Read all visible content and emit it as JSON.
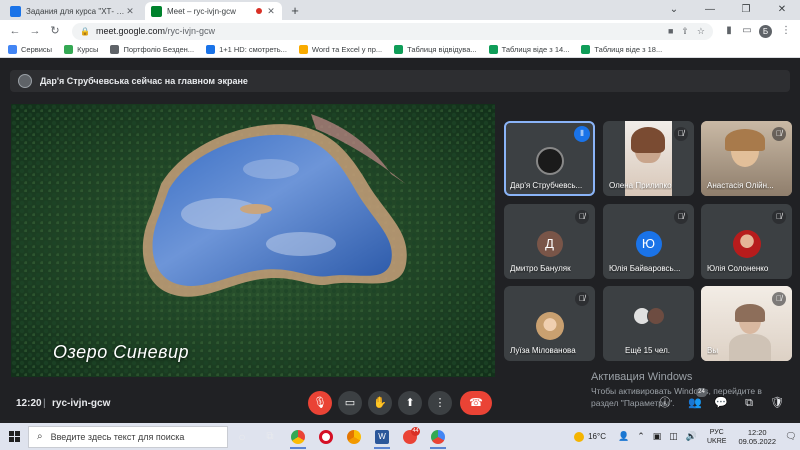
{
  "browser": {
    "tabs": [
      {
        "title": "Задания для курса \"ХТ- 149 ФЭ...",
        "favicon_color": "#1a73e8",
        "active": false
      },
      {
        "title": "Meet – ryc-ivjn-gcw",
        "favicon_color": "#00832d",
        "active": true
      }
    ],
    "new_tab_glyph": "+",
    "window_controls": {
      "minimize": "⌄",
      "min2": "—",
      "restore": "❐",
      "close": "✕"
    },
    "nav": {
      "back": "←",
      "forward": "→",
      "reload": "↻"
    },
    "url_host": "meet.google.com",
    "url_path": "/ryc-ivjn-gcw",
    "profile_initial": "Б",
    "bookmarks": [
      {
        "label": "Сервисы",
        "color": "#4285f4"
      },
      {
        "label": "Курсы",
        "color": "#34a853"
      },
      {
        "label": "Портфоліо Безден...",
        "color": "#5f6368"
      },
      {
        "label": "1+1 HD: смотреть...",
        "color": "#1a73e8"
      },
      {
        "label": "Word та Excel у пр...",
        "color": "#f9ab00"
      },
      {
        "label": "Таблиця відвідува...",
        "color": "#0f9d58"
      },
      {
        "label": "Таблиця віде з 14...",
        "color": "#0f9d58"
      },
      {
        "label": "Таблиця віде з 18...",
        "color": "#0f9d58"
      }
    ]
  },
  "meet": {
    "presenter_banner": "Дар'я Струбчевська сейчас на главном экране",
    "stage_caption": "Озеро Синевир",
    "tiles": [
      {
        "name": "Дар'я Струбчевсь...",
        "kind": "photo",
        "color": "#1a1a1a",
        "bg": "#3c4043",
        "speaking": true,
        "badge": "audio"
      },
      {
        "name": "Олена Прилипко",
        "kind": "video",
        "color": "#c9a58c",
        "bg": "#e9e4df",
        "speaking": false,
        "badge": "mute"
      },
      {
        "name": "Анастасія Олійн...",
        "kind": "video",
        "color": "#d6b08a",
        "bg": "#b9a997",
        "speaking": false,
        "badge": "mute"
      },
      {
        "name": "Дмитро Бануляк",
        "kind": "initial",
        "initial": "Д",
        "color": "#795548",
        "bg": "#3c4043",
        "speaking": false,
        "badge": "mute"
      },
      {
        "name": "Юлія Байваровсь...",
        "kind": "initial",
        "initial": "Ю",
        "color": "#1a73e8",
        "bg": "#3c4043",
        "speaking": false,
        "badge": "mute"
      },
      {
        "name": "Юлія Солоненко",
        "kind": "photo",
        "color": "#b71c1c",
        "bg": "#3c4043",
        "speaking": false,
        "badge": "mute"
      },
      {
        "name": "Луїза Мілованова",
        "kind": "photo",
        "color": "#e8c9a0",
        "bg": "#3c4043",
        "speaking": false,
        "badge": "mute"
      },
      {
        "name": "Ещё 15 чел.",
        "kind": "group",
        "color": "#e8e8e8",
        "bg": "#3c4043",
        "speaking": false,
        "badge": "none"
      },
      {
        "name": "Вы",
        "kind": "video",
        "color": "#d9b8a0",
        "bg": "#ede6de",
        "speaking": false,
        "badge": "mute"
      }
    ],
    "activation_title": "Активация Windows",
    "activation_text": "Чтобы активировать Windows, перейдите в раздел \"Параметры\".",
    "time": "12:20",
    "separator": "|",
    "meeting_code": "ryc-ivjn-gcw",
    "controls": {
      "mic": "🎙",
      "camera": "▭",
      "hand": "✋",
      "present": "⬆",
      "more": "⋮",
      "end": "☎"
    },
    "right_icons": {
      "info": "ⓘ",
      "people": "👥",
      "people_count": "24",
      "chat": "💬",
      "activities": "⧉",
      "safety": "🛡"
    }
  },
  "taskbar": {
    "search_placeholder": "Введите здесь текст для поиска",
    "apps": [
      {
        "name": "cortana",
        "color": "#1f1f1f"
      },
      {
        "name": "task-view",
        "color": "#1f1f1f"
      },
      {
        "name": "chrome",
        "color": "#34a853"
      },
      {
        "name": "opera",
        "color": "#d50f25"
      },
      {
        "name": "chrome-2",
        "color": "#fbbc04"
      },
      {
        "name": "word",
        "color": "#2b579a"
      },
      {
        "name": "yandex",
        "color": "#ea4335",
        "count": "44"
      },
      {
        "name": "chrome-3",
        "color": "#4285f4"
      }
    ],
    "temperature": "16°C",
    "lang_1": "РУС",
    "lang_2": "UKRE",
    "clock_time": "12:20",
    "clock_date": "09.05.2022"
  }
}
